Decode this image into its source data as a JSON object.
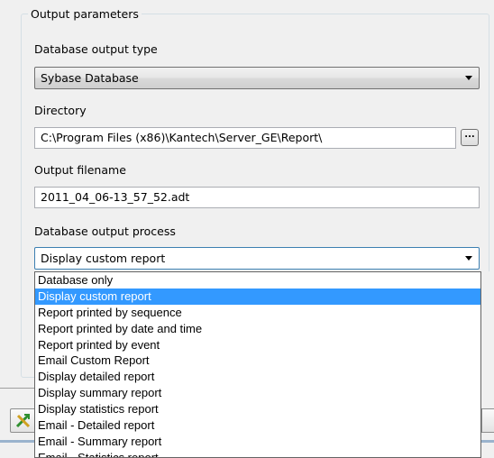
{
  "group": {
    "title": "Output parameters"
  },
  "db_type": {
    "label": "Database output type",
    "value": "Sybase Database"
  },
  "directory": {
    "label": "Directory",
    "value": "C:\\Program Files (x86)\\Kantech\\Server_GE\\Report\\",
    "browse_label": "..."
  },
  "filename": {
    "label": "Output filename",
    "value": "2011_04_06-13_57_52.adt"
  },
  "process": {
    "label": "Database output process",
    "value": "Display custom report",
    "options": [
      "Database only",
      "Display custom report",
      "Report printed by sequence",
      "Report printed by date and time",
      "Report printed by event",
      "Email Custom Report",
      "Display detailed report",
      "Display summary report",
      "Display statistics report",
      "Email - Detailed report",
      "Email - Summary report",
      "Email - Statistics report"
    ],
    "selected_index": 1
  },
  "toolbar": {
    "icon": "green-arrow-x-icon"
  },
  "colors": {
    "selection": "#3399ff",
    "background": "#f0f0f0"
  }
}
